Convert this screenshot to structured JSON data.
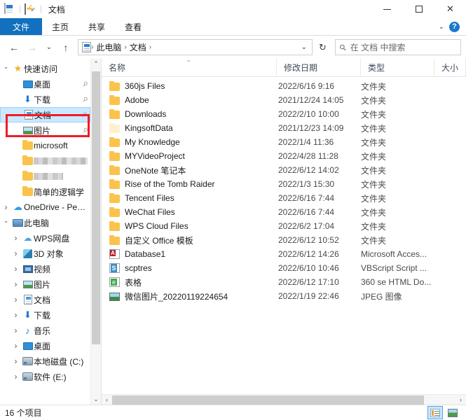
{
  "window": {
    "title": "文档",
    "quick_access_icons": [
      "document-icon",
      "checkbox-icon",
      "folder-icon",
      "dropdown-chevron-icon"
    ],
    "controls": {
      "minimize": "—",
      "maximize": "□",
      "close": "✕"
    }
  },
  "ribbon": {
    "tabs": [
      {
        "label": "文件",
        "active": true
      },
      {
        "label": "主页",
        "active": false
      },
      {
        "label": "共享",
        "active": false
      },
      {
        "label": "查看",
        "active": false
      }
    ],
    "collapse_chevron": "⌄",
    "help_label": "?",
    "accent_color": "#1270bf"
  },
  "address_bar": {
    "back": "←",
    "forward": "→",
    "recent": "⌄",
    "up": "↑",
    "crumbs": [
      "此电脑",
      "文档"
    ],
    "crumb_separator": "›",
    "dropdown_chevron": "⌄",
    "refresh": "↻"
  },
  "search": {
    "icon": "search-icon",
    "placeholder": "在 文档 中搜索"
  },
  "sidebar": {
    "items": [
      {
        "label": "快速访问",
        "icon": "star-icon",
        "expander": "open",
        "indent": 0,
        "pinned": false,
        "selected": false,
        "blurred": false
      },
      {
        "label": "桌面",
        "icon": "desktop-icon",
        "expander": "none",
        "indent": 1,
        "pinned": true,
        "selected": false,
        "blurred": false
      },
      {
        "label": "下载",
        "icon": "download-icon",
        "expander": "none",
        "indent": 1,
        "pinned": true,
        "selected": false,
        "blurred": false
      },
      {
        "label": "文档",
        "icon": "document-icon",
        "expander": "none",
        "indent": 1,
        "pinned": true,
        "selected": true,
        "blurred": false
      },
      {
        "label": "图片",
        "icon": "pictures-icon",
        "expander": "none",
        "indent": 1,
        "pinned": true,
        "selected": false,
        "blurred": false
      },
      {
        "label": "microsoft",
        "icon": "folder-icon",
        "expander": "none",
        "indent": 1,
        "pinned": false,
        "selected": false,
        "blurred": false
      },
      {
        "label": "",
        "icon": "folder-icon",
        "expander": "none",
        "indent": 1,
        "pinned": false,
        "selected": false,
        "blurred": true
      },
      {
        "label": "",
        "icon": "folder-icon",
        "expander": "none",
        "indent": 1,
        "pinned": false,
        "selected": false,
        "blurred": true
      },
      {
        "label": "简单的逻辑学",
        "icon": "folder-icon",
        "expander": "none",
        "indent": 1,
        "pinned": false,
        "selected": false,
        "blurred": false
      },
      {
        "label": "OneDrive - Persc",
        "icon": "cloud-icon",
        "expander": "closed",
        "indent": 0,
        "pinned": false,
        "selected": false,
        "blurred": false
      },
      {
        "label": "此电脑",
        "icon": "pc-icon",
        "expander": "open",
        "indent": 0,
        "pinned": false,
        "selected": false,
        "blurred": false
      },
      {
        "label": "WPS网盘",
        "icon": "wps-cloud-icon",
        "expander": "closed",
        "indent": 1,
        "pinned": false,
        "selected": false,
        "blurred": false
      },
      {
        "label": "3D 对象",
        "icon": "3d-objects-icon",
        "expander": "closed",
        "indent": 1,
        "pinned": false,
        "selected": false,
        "blurred": false
      },
      {
        "label": "视频",
        "icon": "video-icon",
        "expander": "closed",
        "indent": 1,
        "pinned": false,
        "selected": false,
        "blurred": false
      },
      {
        "label": "图片",
        "icon": "pictures-icon",
        "expander": "closed",
        "indent": 1,
        "pinned": false,
        "selected": false,
        "blurred": false
      },
      {
        "label": "文档",
        "icon": "document-icon",
        "expander": "closed",
        "indent": 1,
        "pinned": false,
        "selected": false,
        "blurred": false
      },
      {
        "label": "下载",
        "icon": "download-icon",
        "expander": "closed",
        "indent": 1,
        "pinned": false,
        "selected": false,
        "blurred": false
      },
      {
        "label": "音乐",
        "icon": "music-icon",
        "expander": "closed",
        "indent": 1,
        "pinned": false,
        "selected": false,
        "blurred": false
      },
      {
        "label": "桌面",
        "icon": "desktop-icon",
        "expander": "closed",
        "indent": 1,
        "pinned": false,
        "selected": false,
        "blurred": false
      },
      {
        "label": "本地磁盘 (C:)",
        "icon": "hard-drive-icon",
        "expander": "closed",
        "indent": 1,
        "pinned": false,
        "selected": false,
        "blurred": false
      },
      {
        "label": "软件 (E:)",
        "icon": "hard-drive-icon",
        "expander": "closed",
        "indent": 1,
        "pinned": false,
        "selected": false,
        "blurred": false
      }
    ],
    "scroll_up": "⌃",
    "scroll_down": "⌄"
  },
  "file_list": {
    "columns": [
      {
        "label": "名称",
        "sorted": "asc",
        "sort_glyph": "⌃"
      },
      {
        "label": "修改日期",
        "sorted": "none"
      },
      {
        "label": "类型",
        "sorted": "none"
      },
      {
        "label": "大小",
        "sorted": "none"
      }
    ],
    "rows": [
      {
        "name": "360js Files",
        "date": "2022/6/16 9:16",
        "type": "文件夹",
        "size": "",
        "icon": "folder-icon"
      },
      {
        "name": "Adobe",
        "date": "2021/12/24 14:05",
        "type": "文件夹",
        "size": "",
        "icon": "folder-icon"
      },
      {
        "name": "Downloads",
        "date": "2022/2/10 10:00",
        "type": "文件夹",
        "size": "",
        "icon": "folder-icon"
      },
      {
        "name": "KingsoftData",
        "date": "2021/12/23 14:09",
        "type": "文件夹",
        "size": "",
        "icon": "folder-icon-pale"
      },
      {
        "name": "My Knowledge",
        "date": "2022/1/4 11:36",
        "type": "文件夹",
        "size": "",
        "icon": "folder-icon"
      },
      {
        "name": "MYVideoProject",
        "date": "2022/4/28 11:28",
        "type": "文件夹",
        "size": "",
        "icon": "folder-icon"
      },
      {
        "name": "OneNote 笔记本",
        "date": "2022/6/12 14:02",
        "type": "文件夹",
        "size": "",
        "icon": "folder-icon"
      },
      {
        "name": "Rise of the Tomb Raider",
        "date": "2022/1/3 15:30",
        "type": "文件夹",
        "size": "",
        "icon": "folder-icon"
      },
      {
        "name": "Tencent Files",
        "date": "2022/6/16 7:44",
        "type": "文件夹",
        "size": "",
        "icon": "folder-icon"
      },
      {
        "name": "WeChat Files",
        "date": "2022/6/16 7:44",
        "type": "文件夹",
        "size": "",
        "icon": "folder-icon"
      },
      {
        "name": "WPS Cloud Files",
        "date": "2022/6/2 17:04",
        "type": "文件夹",
        "size": "",
        "icon": "folder-icon"
      },
      {
        "name": "自定义 Office 模板",
        "date": "2022/6/12 10:52",
        "type": "文件夹",
        "size": "",
        "icon": "folder-icon"
      },
      {
        "name": "Database1",
        "date": "2022/6/12 14:26",
        "type": "Microsoft Acces...",
        "size": "",
        "icon": "access-file-icon"
      },
      {
        "name": "scptres",
        "date": "2022/6/10 10:46",
        "type": "VBScript Script ...",
        "size": "",
        "icon": "vbscript-file-icon"
      },
      {
        "name": "表格",
        "date": "2022/6/12 17:10",
        "type": "360 se HTML Do...",
        "size": "",
        "icon": "html-file-icon"
      },
      {
        "name": "微信图片_20220119224654",
        "date": "2022/1/19 22:46",
        "type": "JPEG 图像",
        "size": "",
        "icon": "jpeg-file-icon"
      }
    ],
    "hscroll_left": "‹",
    "hscroll_right": "›"
  },
  "status_bar": {
    "item_count": "16 个项目",
    "view_buttons": [
      {
        "name": "details-view",
        "active": true
      },
      {
        "name": "large-icons-view",
        "active": false
      }
    ]
  },
  "annotation": {
    "color": "#ee1c25",
    "target": "文档"
  }
}
